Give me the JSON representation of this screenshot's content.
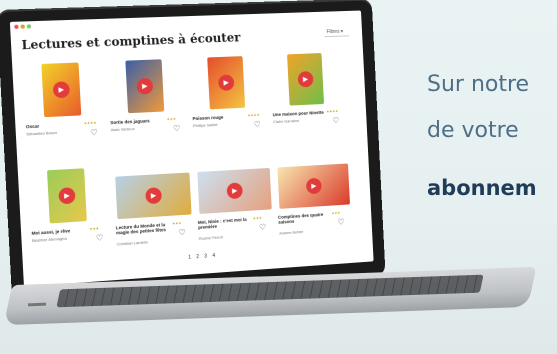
{
  "page": {
    "title": "Lectures et comptines à écouter",
    "filter_label": "Filtres"
  },
  "books": [
    {
      "title": "Oscar",
      "author": "Sébastien Braun",
      "rating": "★★★★",
      "palette": [
        "#f2d22a",
        "#e85b2b"
      ]
    },
    {
      "title": "Sortie des jaguars",
      "author": "Alain Sérieux",
      "rating": "★★★",
      "palette": [
        "#3a5fa8",
        "#f19a3a"
      ]
    },
    {
      "title": "Poisson rouge",
      "author": "Phillipe Saillet",
      "rating": "★★★★",
      "palette": [
        "#e44d2b",
        "#f4c542"
      ]
    },
    {
      "title": "Une maison pour Ninette",
      "author": "Claire Garralon",
      "rating": "★★★★",
      "palette": [
        "#f1a32a",
        "#6fbf4a"
      ]
    },
    {
      "title": "Moi aussi, je rêve",
      "author": "Béatrice Alemagna",
      "rating": "★★★",
      "palette": [
        "#9acd5a",
        "#e7c84b"
      ]
    },
    {
      "title": "Lecture du Monde et la magie des petites fêtes",
      "author": "Christian Lamblin",
      "rating": "★★★",
      "palette": [
        "#b7d0e8",
        "#e0ac3d"
      ]
    },
    {
      "title": "Moi, Ninie : c'est moi la première",
      "author": "Rosine Perrot",
      "rating": "★★★",
      "palette": [
        "#cde0f0",
        "#e4a17f"
      ]
    },
    {
      "title": "Comptines des quatre saisons",
      "author": "Jeanne Ashbé",
      "rating": "★★★",
      "palette": [
        "#f7e6b0",
        "#d93b2b"
      ]
    }
  ],
  "pager": {
    "pages": "1 2 3 4"
  },
  "promo": {
    "line1": "Sur notre",
    "line2": "de votre",
    "line3": "abonnem"
  }
}
